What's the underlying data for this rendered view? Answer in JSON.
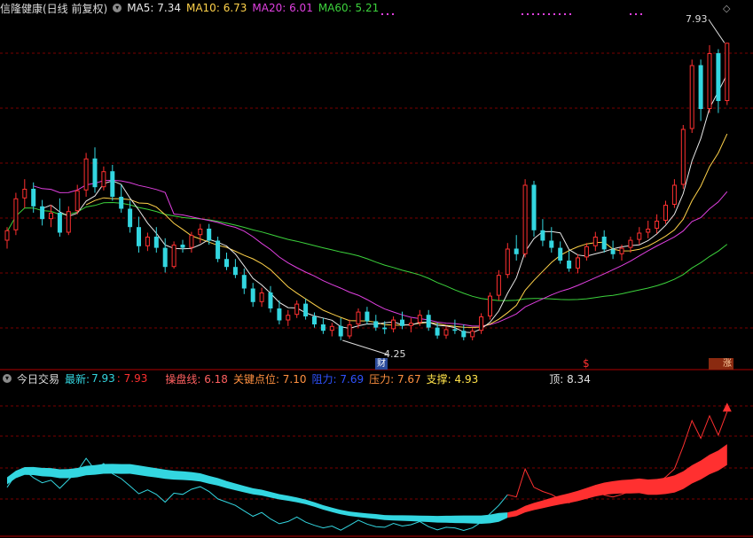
{
  "main_header": {
    "title": "信隆健康(日线 前复权)",
    "items": [
      {
        "label": "MA5:",
        "value": "7.34",
        "color": "#e8e8e8"
      },
      {
        "label": "MA10:",
        "value": "6.73",
        "color": "#ffd24a"
      },
      {
        "label": "MA20:",
        "value": "6.01",
        "color": "#e040e0"
      },
      {
        "label": "MA60:",
        "value": "5.21",
        "color": "#3cd23c"
      }
    ]
  },
  "sub_header": {
    "title": "今日交易",
    "latest_label": "最新:",
    "latest_value": "7.93",
    "latest_value2": ": 7.93",
    "items": [
      {
        "text": "操盘线: 6.18",
        "color": "#ff6060"
      },
      {
        "text": "关键点位: 7.10",
        "color": "#ff9040"
      },
      {
        "text": "阻力: 7.69",
        "color": "#2f52ff"
      },
      {
        "text": "压力: 7.67",
        "color": "#ff9040"
      },
      {
        "text": "支撑: 4.93",
        "color": "#ffe24a"
      },
      {
        "text": "顶: 8.34",
        "color": "#e0e0e0"
      }
    ]
  },
  "annotations": {
    "high_price": "7.93",
    "low_price": "4.25",
    "marker_finance": "财",
    "marker_s": "$",
    "marker_limit": "涨"
  },
  "colors": {
    "up": "#ff3030",
    "down": "#33d6e0",
    "grid": "#7a0000",
    "axis": "#b00000",
    "ma5": "#e8e8e8",
    "ma10": "#ffd24a",
    "ma20": "#e040e0",
    "ma60": "#3cd23c"
  },
  "chart_data": {
    "type": "candlestick",
    "y_range": [
      4.0,
      8.2
    ],
    "candles": [
      [
        5.45,
        5.62,
        5.35,
        5.58
      ],
      [
        5.58,
        6.05,
        5.52,
        5.98
      ],
      [
        5.98,
        6.22,
        5.86,
        6.1
      ],
      [
        6.1,
        6.18,
        5.8,
        5.88
      ],
      [
        5.88,
        5.96,
        5.64,
        5.72
      ],
      [
        5.72,
        5.9,
        5.62,
        5.8
      ],
      [
        5.8,
        5.98,
        5.5,
        5.55
      ],
      [
        5.55,
        5.88,
        5.52,
        5.82
      ],
      [
        5.82,
        6.15,
        5.78,
        6.08
      ],
      [
        6.08,
        6.55,
        6.0,
        6.48
      ],
      [
        6.48,
        6.62,
        6.05,
        6.12
      ],
      [
        6.12,
        6.38,
        6.08,
        6.32
      ],
      [
        6.32,
        6.4,
        5.95,
        6.0
      ],
      [
        6.0,
        6.15,
        5.8,
        5.85
      ],
      [
        5.85,
        5.95,
        5.55,
        5.62
      ],
      [
        5.62,
        5.75,
        5.3,
        5.38
      ],
      [
        5.38,
        5.55,
        5.32,
        5.5
      ],
      [
        5.5,
        5.62,
        5.3,
        5.36
      ],
      [
        5.36,
        5.48,
        5.05,
        5.12
      ],
      [
        5.12,
        5.44,
        5.1,
        5.4
      ],
      [
        5.4,
        5.46,
        5.3,
        5.36
      ],
      [
        5.36,
        5.56,
        5.3,
        5.52
      ],
      [
        5.52,
        5.66,
        5.42,
        5.6
      ],
      [
        5.6,
        5.66,
        5.4,
        5.45
      ],
      [
        5.45,
        5.5,
        5.18,
        5.22
      ],
      [
        5.22,
        5.3,
        5.08,
        5.12
      ],
      [
        5.12,
        5.22,
        4.98,
        5.02
      ],
      [
        5.02,
        5.1,
        4.78,
        4.85
      ],
      [
        4.85,
        4.92,
        4.62,
        4.68
      ],
      [
        4.68,
        4.86,
        4.62,
        4.8
      ],
      [
        4.8,
        4.88,
        4.55,
        4.6
      ],
      [
        4.6,
        4.7,
        4.4,
        4.45
      ],
      [
        4.45,
        4.58,
        4.38,
        4.52
      ],
      [
        4.52,
        4.7,
        4.48,
        4.66
      ],
      [
        4.66,
        4.72,
        4.46,
        4.5
      ],
      [
        4.5,
        4.55,
        4.36,
        4.4
      ],
      [
        4.4,
        4.48,
        4.28,
        4.32
      ],
      [
        4.32,
        4.42,
        4.25,
        4.38
      ],
      [
        4.38,
        4.48,
        4.2,
        4.25
      ],
      [
        4.25,
        4.46,
        4.22,
        4.4
      ],
      [
        4.4,
        4.6,
        4.36,
        4.56
      ],
      [
        4.56,
        4.62,
        4.4,
        4.44
      ],
      [
        4.44,
        4.52,
        4.32,
        4.36
      ],
      [
        4.36,
        4.44,
        4.28,
        4.34
      ],
      [
        4.34,
        4.5,
        4.3,
        4.46
      ],
      [
        4.46,
        4.56,
        4.34,
        4.38
      ],
      [
        4.38,
        4.48,
        4.3,
        4.42
      ],
      [
        4.42,
        4.58,
        4.38,
        4.52
      ],
      [
        4.52,
        4.58,
        4.32,
        4.36
      ],
      [
        4.36,
        4.42,
        4.22,
        4.26
      ],
      [
        4.26,
        4.38,
        4.22,
        4.34
      ],
      [
        4.34,
        4.46,
        4.28,
        4.32
      ],
      [
        4.32,
        4.4,
        4.2,
        4.24
      ],
      [
        4.24,
        4.36,
        4.2,
        4.32
      ],
      [
        4.32,
        4.54,
        4.28,
        4.5
      ],
      [
        4.5,
        4.8,
        4.46,
        4.76
      ],
      [
        4.76,
        5.08,
        4.7,
        5.02
      ],
      [
        5.02,
        5.42,
        4.98,
        5.35
      ],
      [
        5.35,
        5.52,
        5.2,
        5.28
      ],
      [
        5.28,
        6.22,
        5.24,
        6.15
      ],
      [
        6.15,
        6.2,
        5.5,
        5.58
      ],
      [
        5.58,
        5.72,
        5.38,
        5.45
      ],
      [
        5.45,
        5.62,
        5.3,
        5.36
      ],
      [
        5.36,
        5.44,
        5.16,
        5.2
      ],
      [
        5.2,
        5.32,
        5.06,
        5.1
      ],
      [
        5.1,
        5.28,
        5.04,
        5.24
      ],
      [
        5.24,
        5.42,
        5.2,
        5.38
      ],
      [
        5.38,
        5.56,
        5.32,
        5.5
      ],
      [
        5.5,
        5.58,
        5.3,
        5.34
      ],
      [
        5.34,
        5.45,
        5.22,
        5.28
      ],
      [
        5.28,
        5.4,
        5.2,
        5.36
      ],
      [
        5.36,
        5.5,
        5.3,
        5.46
      ],
      [
        5.46,
        5.62,
        5.4,
        5.55
      ],
      [
        5.55,
        5.7,
        5.48,
        5.6
      ],
      [
        5.6,
        5.78,
        5.54,
        5.7
      ],
      [
        5.7,
        5.95,
        5.66,
        5.9
      ],
      [
        5.9,
        6.22,
        5.86,
        6.15
      ],
      [
        6.15,
        6.9,
        6.1,
        6.85
      ],
      [
        6.85,
        7.72,
        6.8,
        7.65
      ],
      [
        7.65,
        7.72,
        6.95,
        7.1
      ],
      [
        7.1,
        7.9,
        7.05,
        7.8
      ],
      [
        7.8,
        7.85,
        7.05,
        7.2
      ],
      [
        7.2,
        7.93,
        7.15,
        7.93
      ]
    ]
  }
}
